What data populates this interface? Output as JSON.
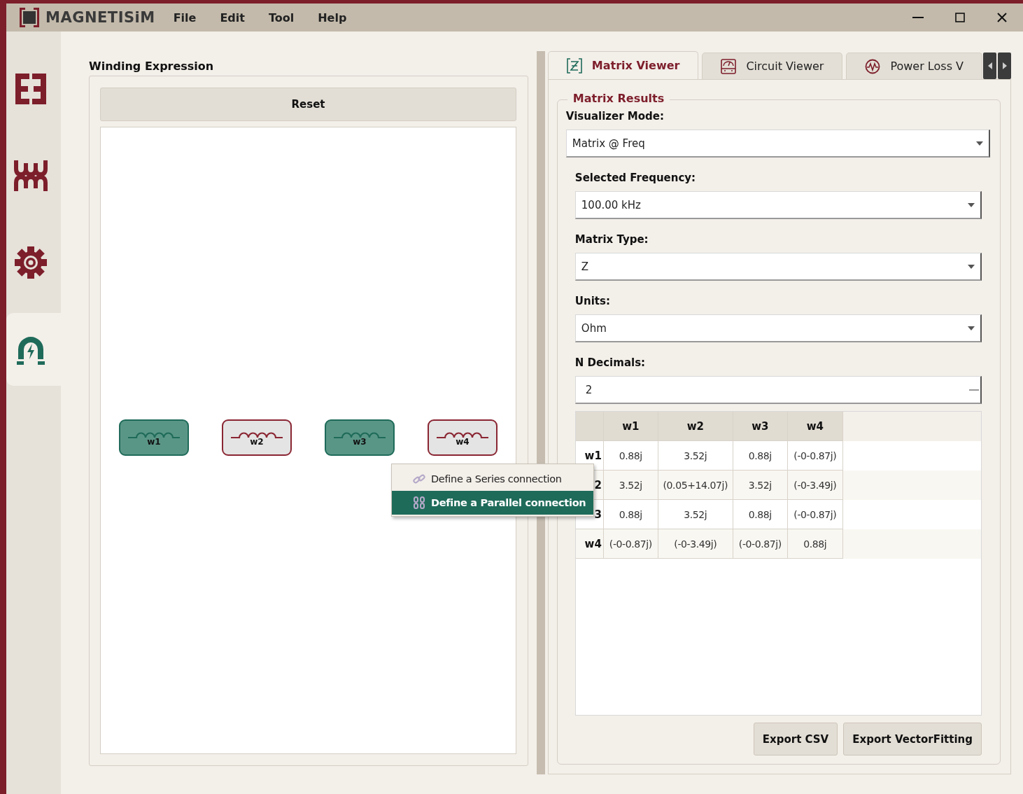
{
  "app": {
    "name": "MAGNETISiM"
  },
  "menu": [
    "File",
    "Edit",
    "Tool",
    "Help"
  ],
  "sidebar": {
    "items": [
      {
        "selected": false
      },
      {
        "selected": false
      },
      {
        "selected": false
      },
      {
        "selected": true
      }
    ]
  },
  "winding_panel": {
    "title": "Winding Expression",
    "reset": "Reset",
    "windings": [
      {
        "label": "w1",
        "selected": true
      },
      {
        "label": "w2",
        "selected": false
      },
      {
        "label": "w3",
        "selected": true
      },
      {
        "label": "w4",
        "selected": false
      }
    ]
  },
  "context_menu": {
    "items": [
      {
        "label": "Define a Series connection",
        "highlighted": false
      },
      {
        "label": "Define a Parallel connection",
        "highlighted": true
      }
    ]
  },
  "tabs": [
    {
      "label": "Matrix Viewer",
      "selected": true
    },
    {
      "label": "Circuit Viewer",
      "selected": false
    },
    {
      "label": "Power Loss V",
      "selected": false
    }
  ],
  "matrix_results": {
    "title": "Matrix Results",
    "fields": [
      {
        "label": "Visualizer Mode:",
        "value": "Matrix @ Freq",
        "kind": "dropdown"
      },
      {
        "label": "Selected Frequency:",
        "value": "100.00 kHz",
        "kind": "dropdown"
      },
      {
        "label": "Matrix Type:",
        "value": "Z",
        "kind": "dropdown"
      },
      {
        "label": "Units:",
        "value": "Ohm",
        "kind": "dropdown"
      },
      {
        "label": "N Decimals:",
        "value": "2",
        "kind": "spinbox"
      }
    ],
    "table": {
      "columns": [
        "w1",
        "w2",
        "w3",
        "w4"
      ],
      "rows": [
        {
          "header": "w1",
          "cells": [
            "0.88j",
            "3.52j",
            "0.88j",
            "(-0-0.87j)"
          ]
        },
        {
          "header": "2",
          "cells": [
            "3.52j",
            "(0.05+14.07j)",
            "3.52j",
            "(-0-3.49j)"
          ]
        },
        {
          "header": "3",
          "cells": [
            "0.88j",
            "3.52j",
            "0.88j",
            "(-0-0.87j)"
          ]
        },
        {
          "header": "w4",
          "cells": [
            "(-0-0.87j)",
            "(-0-3.49j)",
            "(-0-0.87j)",
            "0.88j"
          ]
        }
      ]
    }
  },
  "buttons": [
    "Export CSV",
    "Export VectorFitting"
  ]
}
